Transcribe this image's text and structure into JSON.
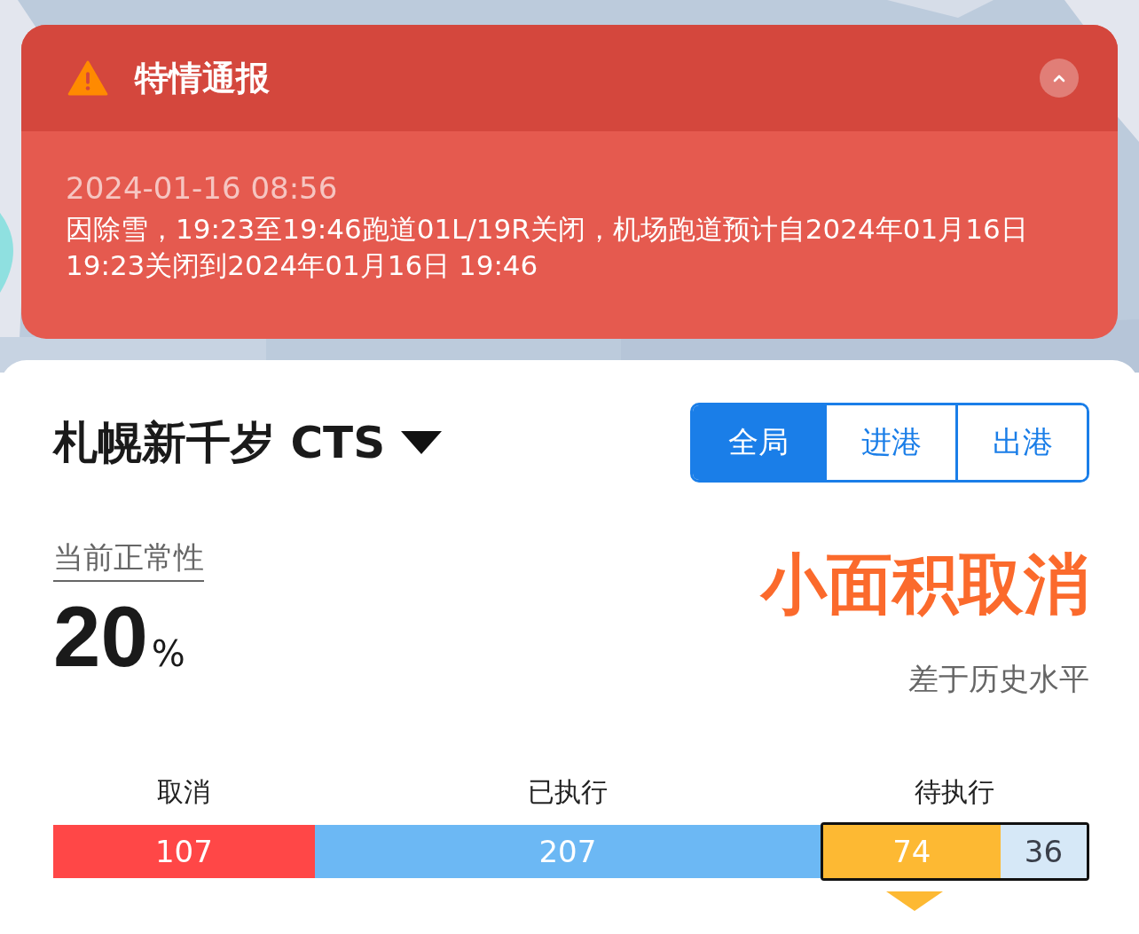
{
  "alert": {
    "title": "特情通报",
    "expanded": true,
    "time": "2024-01-16 08:56",
    "message": "因除雪，19:23至19:46跑道01L/19R关闭，机场跑道预计自2024年01月16日 19:23关闭到2024年01月16日 19:46"
  },
  "airport": {
    "name": "札幌新千岁 CTS"
  },
  "tabs": [
    {
      "label": "全局",
      "selected": true
    },
    {
      "label": "进港",
      "selected": false
    },
    {
      "label": "出港",
      "selected": false
    }
  ],
  "normality": {
    "label": "当前正常性",
    "value": "20",
    "unit": "%"
  },
  "status": {
    "title": "小面积取消",
    "subtitle": "差于历史水平"
  },
  "flight_bar": [
    {
      "label": "取消",
      "selected": false,
      "segments": [
        {
          "value": "107",
          "color": "#ff4747"
        }
      ]
    },
    {
      "label": "已执行",
      "selected": false,
      "segments": [
        {
          "value": "207",
          "color": "#6cb8f4"
        }
      ]
    },
    {
      "label": "待执行",
      "selected": true,
      "segments": [
        {
          "value": "74",
          "color": "#fdb933"
        },
        {
          "value": "36",
          "color": "#d6e8f7"
        }
      ]
    }
  ]
}
